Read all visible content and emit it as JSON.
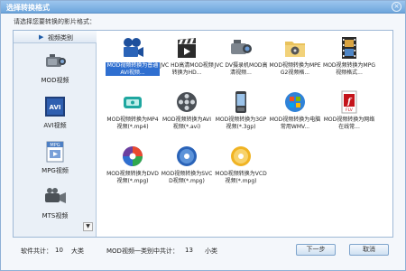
{
  "window": {
    "title": "选择转换格式",
    "close_symbol": "×"
  },
  "prompt": "请选择您要转换的影片格式：",
  "sidebar": {
    "header": {
      "arrow": "▶",
      "label": "视频类别"
    },
    "categories": [
      {
        "label": "MOD视频",
        "icon": "camcorder-icon"
      },
      {
        "label": "AVI视频",
        "icon": "avi-file-icon"
      },
      {
        "label": "MPG视频",
        "icon": "mpg-file-icon"
      },
      {
        "label": "MTS视频",
        "icon": "video-camera-icon"
      }
    ],
    "scroll_down_symbol": "▼"
  },
  "formats": [
    {
      "label": "MOD视频转换为普通AVI视频...",
      "icon": "movie-camera-icon",
      "selected": true
    },
    {
      "label": "JVC HD高清MOD视频转换为HD...",
      "icon": "clapperboard-icon"
    },
    {
      "label": "JVC DV摄录机MOD高清视频...",
      "icon": "dv-camcorder-icon"
    },
    {
      "label": "MOD视频转换为MPEG2视频格...",
      "icon": "film-folder-icon"
    },
    {
      "label": "MOD视频转换为MPG视频格式...",
      "icon": "film-strip-icon"
    },
    {
      "label": "MOD视频转换为MP4视频(*.mp4)",
      "icon": "mp4-player-icon"
    },
    {
      "label": "MOD视频转换为AVI视频(*.avi)",
      "icon": "film-reel-icon"
    },
    {
      "label": "MOD视频转换为3GP视频(*.3gp)",
      "icon": "mobile-phone-icon"
    },
    {
      "label": "MOD视频转换为电脑常用WMV...",
      "icon": "windows-media-icon"
    },
    {
      "label": "MOD视频转换为网络在线常...",
      "icon": "flash-flv-icon"
    },
    {
      "label": "MOD视频转换为DVD视频(*.mpg)",
      "icon": "dvd-disc-icon"
    },
    {
      "label": "MOD视频转换为SVCD视频(*.mpg)",
      "icon": "svcd-disc-icon"
    },
    {
      "label": "MOD视频转换为VCD视频(*.mpg)",
      "icon": "vcd-disc-icon"
    }
  ],
  "footer": {
    "software_total_label": "软件共计：",
    "software_total_value": "10",
    "software_total_unit": "大类",
    "category_total_label": "MOD视频一类别中共计：",
    "category_total_value": "13",
    "category_total_unit": "小类",
    "next_label": "下一步",
    "cancel_label": "取消"
  },
  "colors": {
    "title_bar": "#6ea6dc",
    "selection": "#2f6fd0",
    "border": "#9fb9d6"
  }
}
